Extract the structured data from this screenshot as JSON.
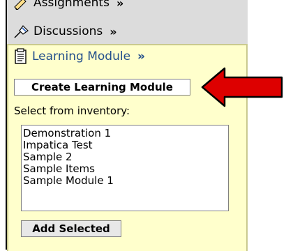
{
  "nav": {
    "assignments_label": "Assignments",
    "assignments_chev": "»",
    "discussions_label": "Discussions",
    "discussions_chev": "»",
    "learning_label": "Learning Module",
    "learning_chev": "»"
  },
  "learning_module": {
    "create_button": "Create Learning Module",
    "select_label": "Select from inventory:",
    "inventory_items": [
      "Demonstration 1",
      "Impatica Test",
      "Sample 2",
      "Sample Items",
      "Sample Module 1"
    ],
    "add_button": "Add Selected"
  },
  "icons": {
    "assignments": "pencil-icon",
    "discussions": "pin-icon",
    "learning": "document-icon",
    "pointer": "red-arrow-icon"
  },
  "colors": {
    "panel_bg": "#dcdcdc",
    "learning_bg": "#ffffcc",
    "link_blue": "#234f8c",
    "arrow_red": "#dd0000"
  }
}
